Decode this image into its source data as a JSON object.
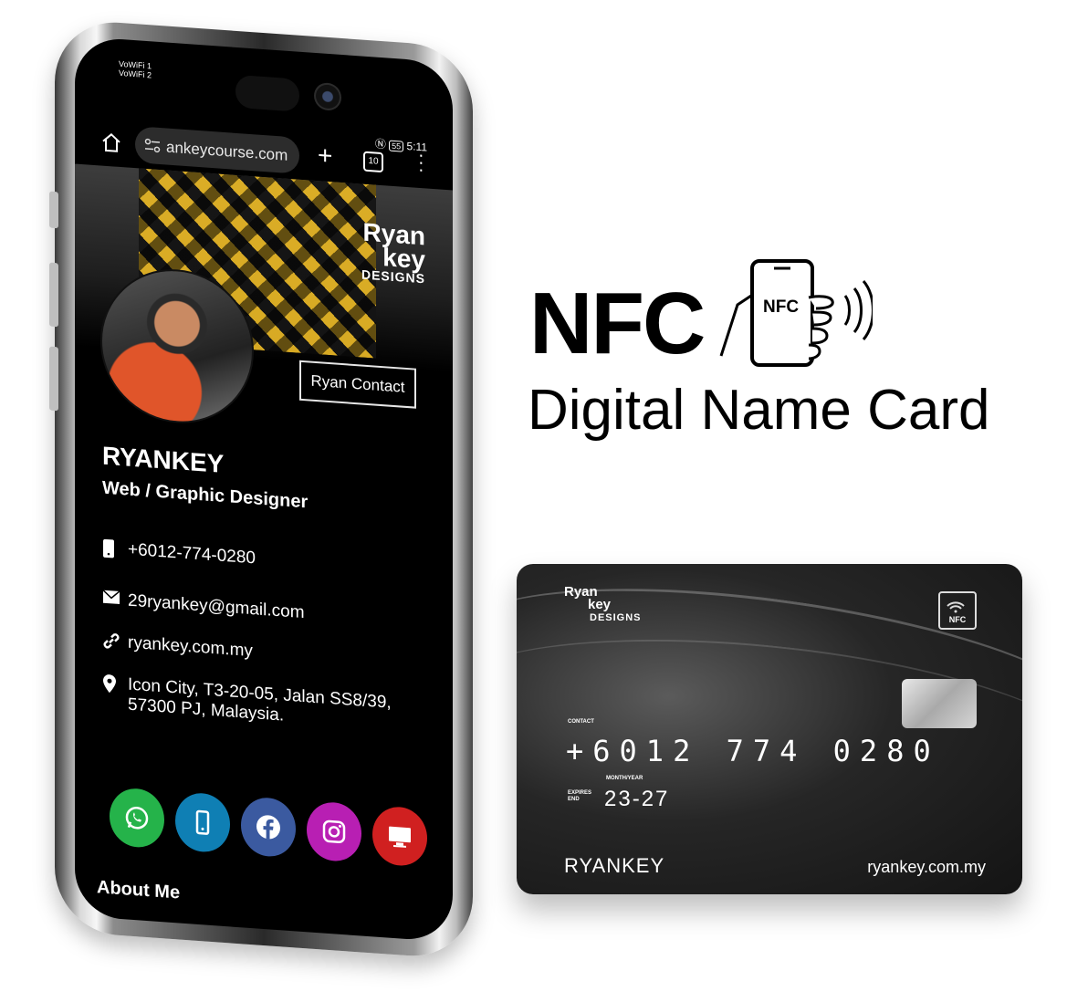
{
  "status_bar": {
    "sim1": "VoWiFi 1",
    "sim2": "VoWiFi 2",
    "battery": "55",
    "time": "5:11"
  },
  "browser": {
    "url": "ankeycourse.com",
    "tab_count": "10"
  },
  "profile": {
    "logo_line1": "Ryan",
    "logo_line2": "key",
    "logo_line3": "DESIGNS",
    "contact_button": "Ryan Contact",
    "name": "RYANKEY",
    "role": "Web / Graphic Designer",
    "phone": "+6012-774-0280",
    "email": "29ryankey@gmail.com",
    "website": "ryankey.com.my",
    "address_line1": "Icon City, T3-20-05, Jalan SS8/39,",
    "address_line2": "57300 PJ, Malaysia.",
    "about_heading": "About Me"
  },
  "socials": [
    {
      "icon": "whatsapp-icon",
      "color": "#25b34a"
    },
    {
      "icon": "phone-icon",
      "color": "#0f7fb4"
    },
    {
      "icon": "facebook-icon",
      "color": "#3b5aa0"
    },
    {
      "icon": "instagram-icon",
      "color": "#b81fb3"
    },
    {
      "icon": "desktop-icon",
      "color": "#d02020"
    }
  ],
  "promo": {
    "headline": "NFC",
    "hand_label": "NFC",
    "subtitle": "Digital Name Card"
  },
  "card": {
    "logo_line1": "Ryan",
    "logo_line2": "key",
    "logo_line3": "DESIGNS",
    "nfc_label": "NFC",
    "contact_label": "CONTACT",
    "number": "+6012 774 0280",
    "expiry_label_left": "EXPIRES END",
    "expiry_label_top": "MONTH/YEAR",
    "expiry": "23-27",
    "holder": "RYANKEY",
    "website": "ryankey.com.my"
  }
}
